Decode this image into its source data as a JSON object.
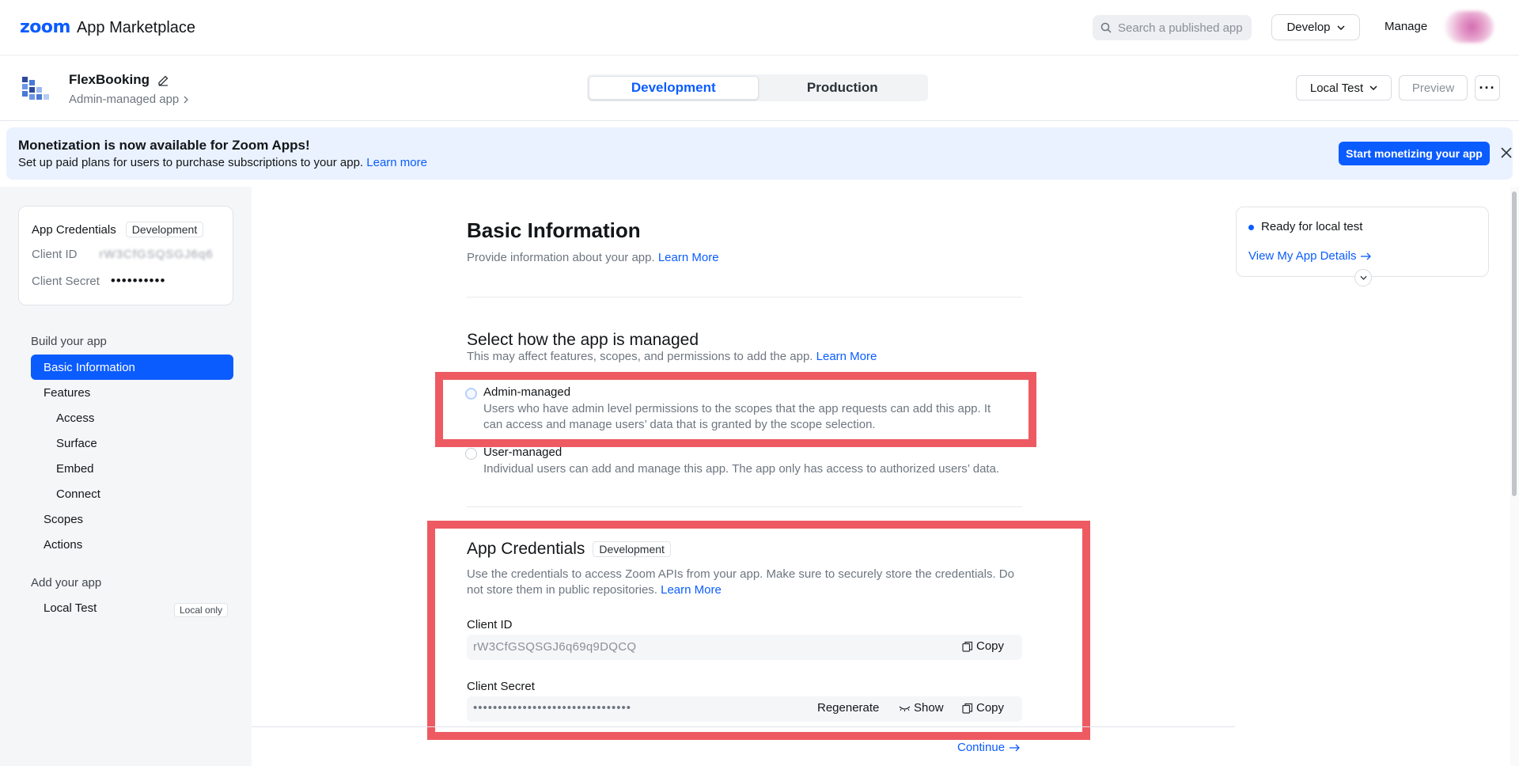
{
  "topbar": {
    "logo_zoom": "zoom",
    "logo_text": "App Marketplace",
    "search_placeholder": "Search a published app",
    "develop_label": "Develop",
    "manage_label": "Manage"
  },
  "app": {
    "name": "FlexBooking",
    "type": "Admin-managed app",
    "env_tabs": [
      {
        "label": "Development",
        "active": true
      },
      {
        "label": "Production",
        "active": false
      }
    ],
    "local_test_label": "Local Test",
    "preview_label": "Preview",
    "more_label": "···"
  },
  "banner": {
    "title": "Monetization is now available for Zoom Apps!",
    "desc": "Set up paid plans for users to purchase subscriptions to your app.",
    "link": "Learn more",
    "button": "Start monetizing your app"
  },
  "sidebar": {
    "cred_title": "App Credentials",
    "cred_badge": "Development",
    "client_id_label": "Client ID",
    "client_id_value": "rW3CfGSQSGJ6q6",
    "client_secret_label": "Client Secret",
    "client_secret_value": "••••••••••",
    "build_section": "Build your app",
    "items": {
      "basic": "Basic Information",
      "features": "Features",
      "access": "Access",
      "surface": "Surface",
      "embed": "Embed",
      "connect": "Connect",
      "scopes": "Scopes",
      "actions": "Actions"
    },
    "add_section": "Add your app",
    "local_test": "Local Test",
    "local_badge": "Local only"
  },
  "main": {
    "title": "Basic Information",
    "subtitle": "Provide information about your app.",
    "subtitle_link": "Learn More",
    "manage_title": "Select how the app is managed",
    "manage_desc": "This may affect features, scopes, and permissions to add the app.",
    "manage_link": "Learn More",
    "admin_label": "Admin-managed",
    "admin_desc": "Users who have admin level permissions to the scopes that the app requests can add this app. It can access and manage users’ data that is granted by the scope selection.",
    "user_label": "User-managed",
    "user_desc": "Individual users can add and manage this app. The app only has access to authorized users’ data.",
    "cred_title": "App Credentials",
    "cred_badge": "Development",
    "cred_desc": "Use the credentials to access Zoom APIs from your app. Make sure to securely store the credentials. Do not store them in public repositories.",
    "cred_link": "Learn More",
    "client_id_label": "Client ID",
    "client_id_value": "rW3CfGSQSGJ6q69q9DQCQ",
    "copy_label": "Copy",
    "client_secret_label": "Client Secret",
    "client_secret_value": "••••••••••••••••••••••••••••••••",
    "regenerate_label": "Regenerate",
    "show_label": "Show",
    "continue_label": "Continue"
  },
  "status": {
    "text": "Ready for local test",
    "link": "View My App Details"
  },
  "colors": {
    "accent": "#0b5cff",
    "highlight": "#ee5a62",
    "banner_bg": "#eaf2ff",
    "sidebar_bg": "#f5f6f8"
  }
}
